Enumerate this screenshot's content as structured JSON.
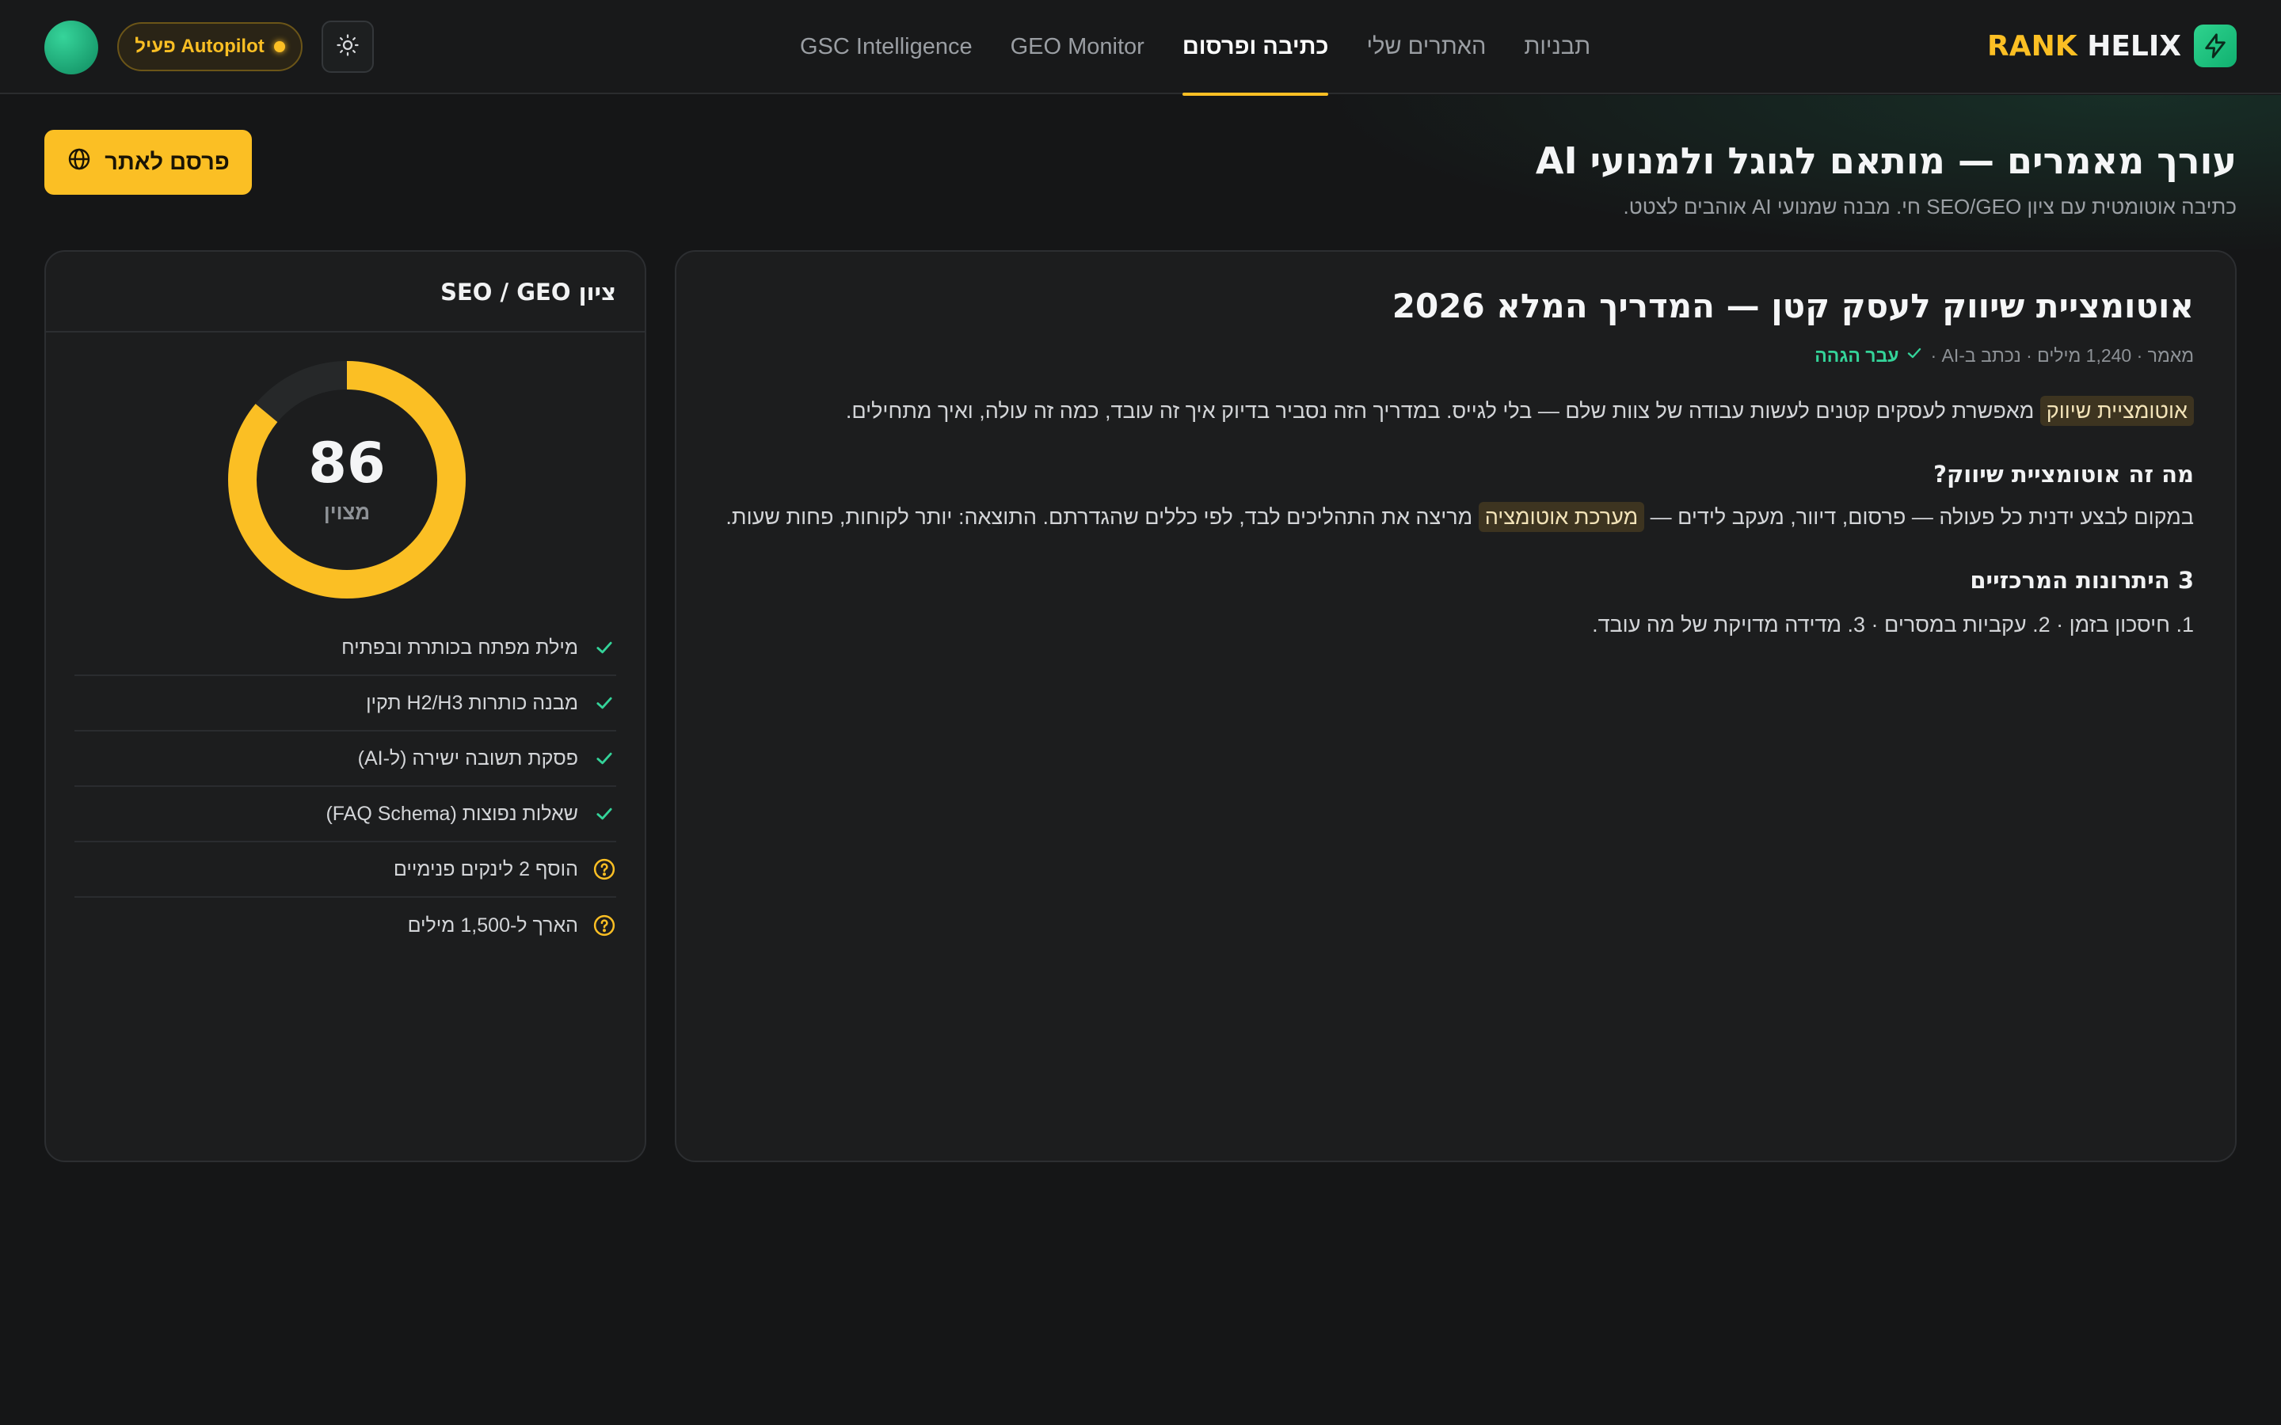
{
  "brand": {
    "part1": "RANK",
    "part2": "HELIX"
  },
  "nav": {
    "items": [
      {
        "label": "GSC Intelligence",
        "active": false
      },
      {
        "label": "GEO Monitor",
        "active": false
      },
      {
        "label": "כתיבה ופרסום",
        "active": true
      },
      {
        "label": "האתרים שלי",
        "active": false
      },
      {
        "label": "תבניות",
        "active": false
      }
    ]
  },
  "autopilot": {
    "label": "Autopilot פעיל"
  },
  "header": {
    "title": "עורך מאמרים — מותאם לגוגל ולמנועי AI",
    "subtitle": "כתיבה אוטומטית עם ציון SEO/GEO חי. מבנה שמנועי AI אוהבים לצטט.",
    "publish_label": "פרסם לאתר"
  },
  "editor": {
    "title": "אוטומציית שיווק לעסק קטן — המדריך המלא 2026",
    "meta": "מאמר · 1,240 מילים · נכתב ב-AI ·",
    "verified": "עבר הגהה",
    "intro_highlight": "אוטומציית שיווק",
    "intro_rest": " מאפשרת לעסקים קטנים לעשות עבודה של צוות שלם — בלי לגייס. במדריך הזה נסביר בדיוק איך זה עובד, כמה זה עולה, ואיך מתחילים.",
    "section1_heading": "מה זה אוטומציית שיווק?",
    "section1_before": "במקום לבצע ידנית כל פעולה — פרסום, דיוור, מעקב לידים — ",
    "section1_highlight": "מערכת אוטומציה",
    "section1_after": " מריצה את התהליכים לבד, לפי כללים שהגדרתם. התוצאה: יותר לקוחות, פחות שעות.",
    "section2_heading": "3 היתרונות המרכזיים",
    "section2_text": "1. חיסכון בזמן · 2. עקביות במסרים · 3. מדידה מדויקת של מה עובד."
  },
  "score": {
    "title": "ציון SEO / GEO",
    "value": 86,
    "max": 100,
    "label": "מצוין",
    "checklist": [
      {
        "label": "מילת מפתח בכותרת ובפתיח",
        "status": "done"
      },
      {
        "label": "מבנה כותרות H2/H3 תקין",
        "status": "done"
      },
      {
        "label": "פסקת תשובה ישירה (ל-AI)",
        "status": "done"
      },
      {
        "label": "שאלות נפוצות (FAQ Schema)",
        "status": "done"
      },
      {
        "label": "הוסף 2 לינקים פנימיים",
        "status": "todo"
      },
      {
        "label": "הארך ל-1,500 מילים",
        "status": "todo"
      }
    ]
  },
  "colors": {
    "accent": "#fbbf24",
    "success": "#34d399",
    "background": "#151617",
    "card": "#1c1d1e"
  },
  "icons": {
    "brand": "bolt-icon",
    "theme": "sun-icon",
    "publish": "globe-icon",
    "check_done": "check-icon",
    "check_todo": "help-circle-icon"
  }
}
